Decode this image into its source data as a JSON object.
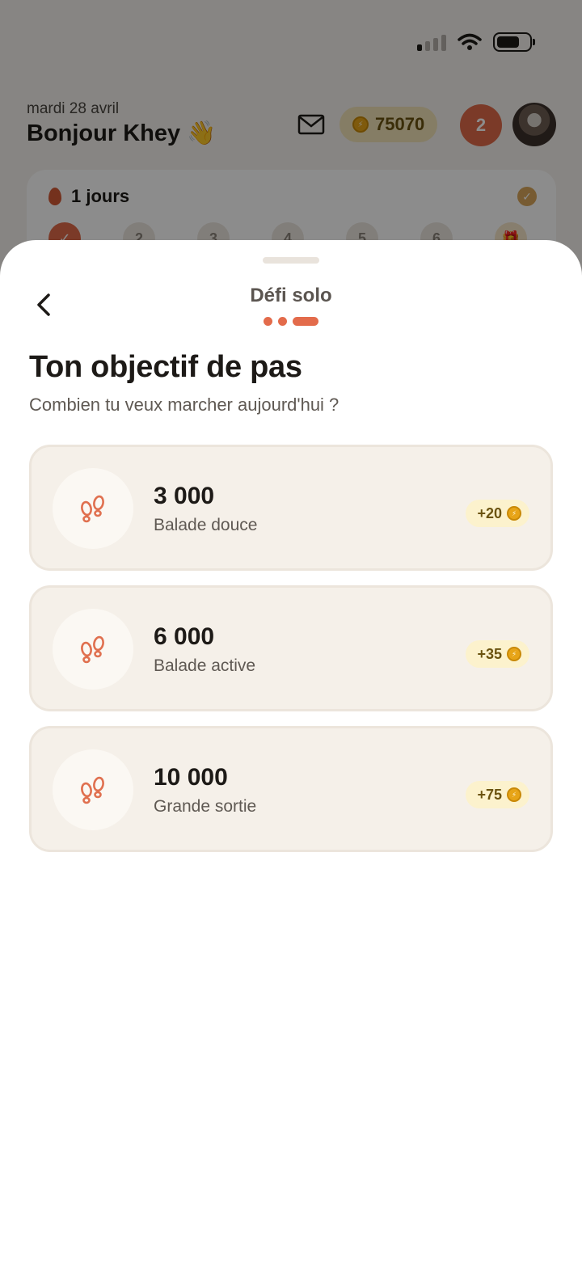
{
  "home": {
    "date": "mardi 28 avril",
    "greeting": "Bonjour Khey 👋",
    "coins": "75070",
    "notifications": "2",
    "streak_label": "1 jours",
    "days": [
      "✓",
      "2",
      "3",
      "4",
      "5",
      "6",
      "🎁"
    ]
  },
  "sheet": {
    "title": "Défi solo",
    "heading": "Ton objectif de pas",
    "subheading": "Combien tu veux marcher aujourd'hui ?",
    "step_indicator": {
      "current": 3,
      "total": 3
    },
    "options": [
      {
        "value": "3 000",
        "label": "Balade douce",
        "reward": "+20",
        "icon": "footprints-icon"
      },
      {
        "value": "6 000",
        "label": "Balade active",
        "reward": "+35",
        "icon": "footprints-icon"
      },
      {
        "value": "10 000",
        "label": "Grande sortie",
        "reward": "+75",
        "icon": "footprints-icon"
      }
    ]
  },
  "colors": {
    "accent": "#e36b4b",
    "card_bg": "#f5f0e9",
    "reward_bg": "#fcf2cd",
    "coin": "#e7a417"
  }
}
